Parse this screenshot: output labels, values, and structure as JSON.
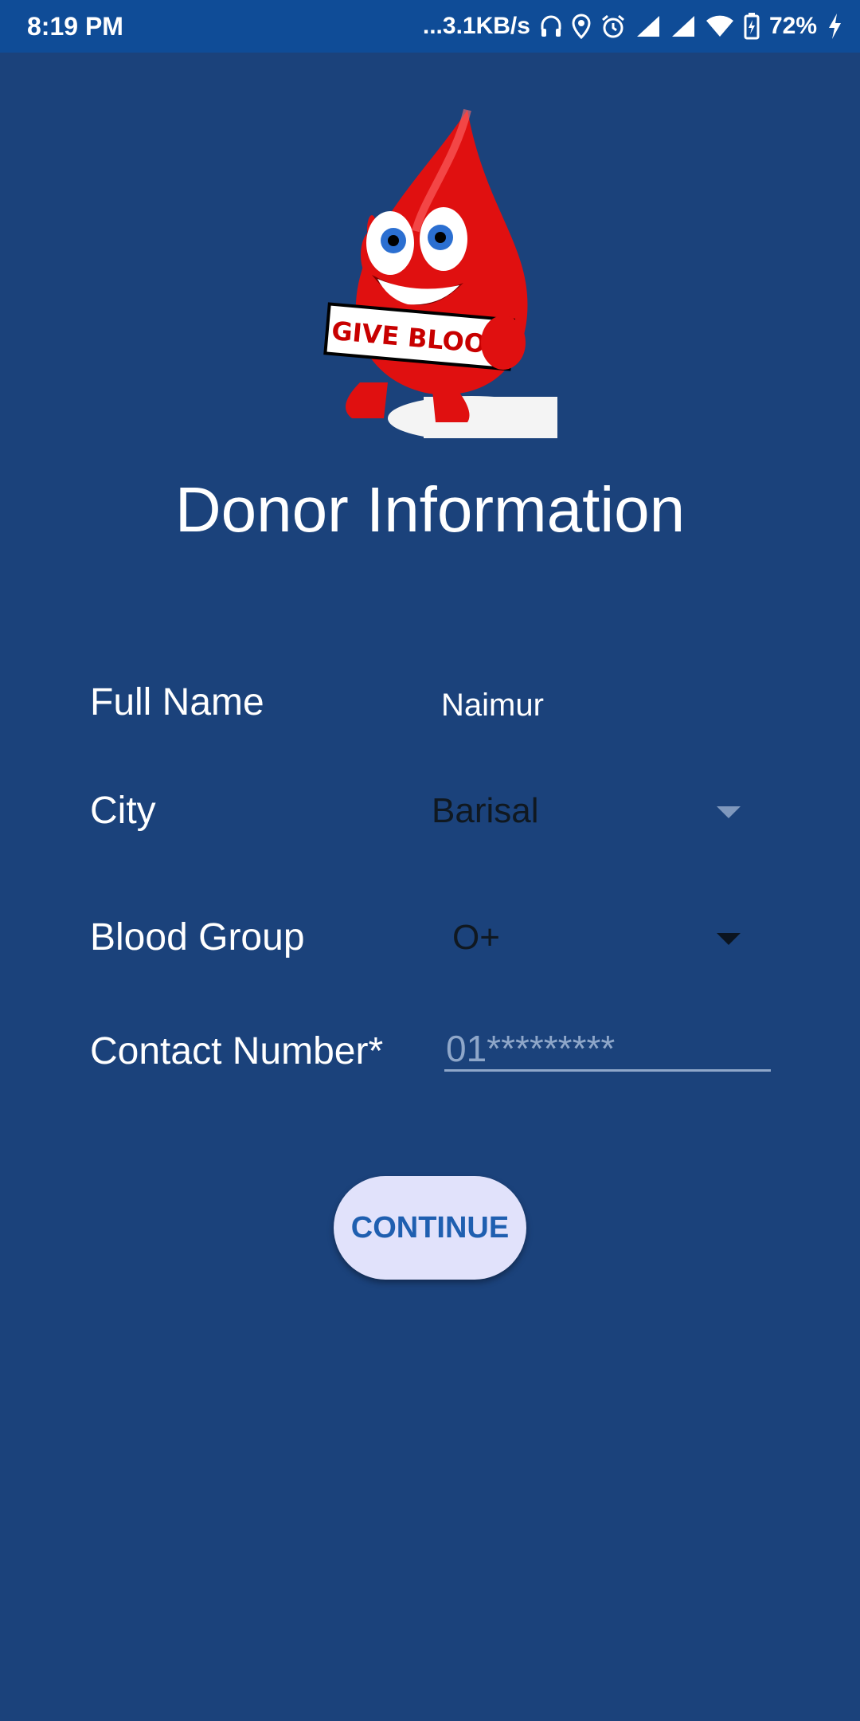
{
  "status_bar": {
    "time": "8:19 PM",
    "network_speed": "...3.1KB/s",
    "battery": "72%",
    "icons": [
      "headphones-icon",
      "location-icon",
      "alarm-icon",
      "signal-icon",
      "signal-icon",
      "wifi-icon",
      "battery-icon",
      "charging-icon"
    ]
  },
  "header": {
    "logo_text": "GIVE BLOOD",
    "title": "Donor Information"
  },
  "form": {
    "full_name": {
      "label": "Full Name",
      "value": "Naimur"
    },
    "city": {
      "label": "City",
      "selected": "Barisal"
    },
    "blood_group": {
      "label": "Blood Group",
      "selected": "O+"
    },
    "contact": {
      "label": "Contact Number*",
      "placeholder": "01*********"
    }
  },
  "actions": {
    "continue_label": "CONTINUE"
  },
  "colors": {
    "background": "#1b427b",
    "status_bar": "#0f4c97",
    "button_bg": "#e1e2fb",
    "button_text": "#1f5fb0"
  }
}
